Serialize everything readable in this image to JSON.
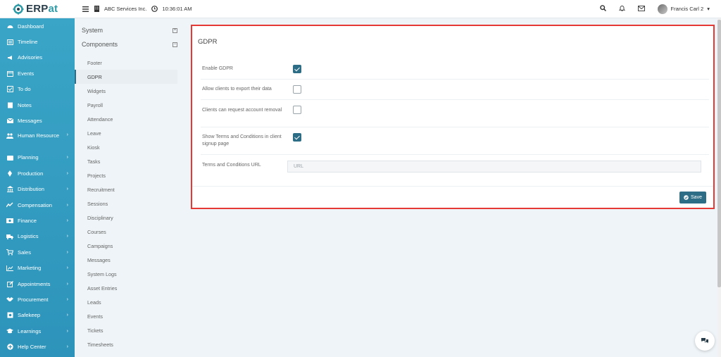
{
  "brand": {
    "logo_prefix": "ERP",
    "logo_suffix": "at",
    "accent_color": "#2e9aa6"
  },
  "topbar": {
    "company": "ABC Services Inc.",
    "time": "10:36:01 AM",
    "user_name": "Francis Carl 2"
  },
  "sidebar": {
    "items": [
      {
        "label": "Dashboard",
        "icon": "dashboard-icon",
        "has_children": false
      },
      {
        "label": "Timeline",
        "icon": "timeline-icon",
        "has_children": false
      },
      {
        "label": "Advisories",
        "icon": "megaphone-icon",
        "has_children": false
      },
      {
        "label": "Events",
        "icon": "calendar-icon",
        "has_children": false
      },
      {
        "label": "To do",
        "icon": "checkbox-icon",
        "has_children": false
      },
      {
        "label": "Notes",
        "icon": "notes-icon",
        "has_children": false
      },
      {
        "label": "Messages",
        "icon": "envelope-icon",
        "has_children": false
      },
      {
        "label": "Human Resource",
        "icon": "people-icon",
        "has_children": true
      },
      {
        "label": "Planning",
        "icon": "planning-icon",
        "has_children": true
      },
      {
        "label": "Production",
        "icon": "production-icon",
        "has_children": true
      },
      {
        "label": "Distribution",
        "icon": "bank-icon",
        "has_children": true
      },
      {
        "label": "Compensation",
        "icon": "compensation-icon",
        "has_children": true
      },
      {
        "label": "Finance",
        "icon": "money-icon",
        "has_children": true
      },
      {
        "label": "Logistics",
        "icon": "truck-icon",
        "has_children": true
      },
      {
        "label": "Sales",
        "icon": "cart-icon",
        "has_children": true
      },
      {
        "label": "Marketing",
        "icon": "chart-icon",
        "has_children": true
      },
      {
        "label": "Appointments",
        "icon": "edit-icon",
        "has_children": true
      },
      {
        "label": "Procurement",
        "icon": "handshake-icon",
        "has_children": true
      },
      {
        "label": "Safekeep",
        "icon": "safe-icon",
        "has_children": true
      },
      {
        "label": "Learnings",
        "icon": "graduation-cap-icon",
        "has_children": true
      },
      {
        "label": "Help Center",
        "icon": "help-icon",
        "has_children": true
      }
    ]
  },
  "settings_nav": {
    "system_label": "System",
    "components_label": "Components",
    "components": [
      "Footer",
      "GDPR",
      "Widgets",
      "Payroll",
      "Attendance",
      "Leave",
      "Kiosk",
      "Tasks",
      "Projects",
      "Recruitment",
      "Sessions",
      "Disciplinary",
      "Courses",
      "Campaigns",
      "Messages",
      "System Logs",
      "Asset Entries",
      "Leads",
      "Events",
      "Tickets",
      "Timesheets"
    ],
    "active": "GDPR"
  },
  "gdpr": {
    "title": "GDPR",
    "enable_label": "Enable GDPR",
    "enable_checked": true,
    "export_label": "Allow clients to export their data",
    "export_checked": false,
    "removal_label": "Clients can request account removal",
    "removal_checked": false,
    "terms_label": "Show Terms and Conditions in client signup page",
    "terms_checked": true,
    "url_label": "Terms and Conditions URL",
    "url_value": "",
    "url_placeholder": "URL",
    "save_label": "Save"
  }
}
